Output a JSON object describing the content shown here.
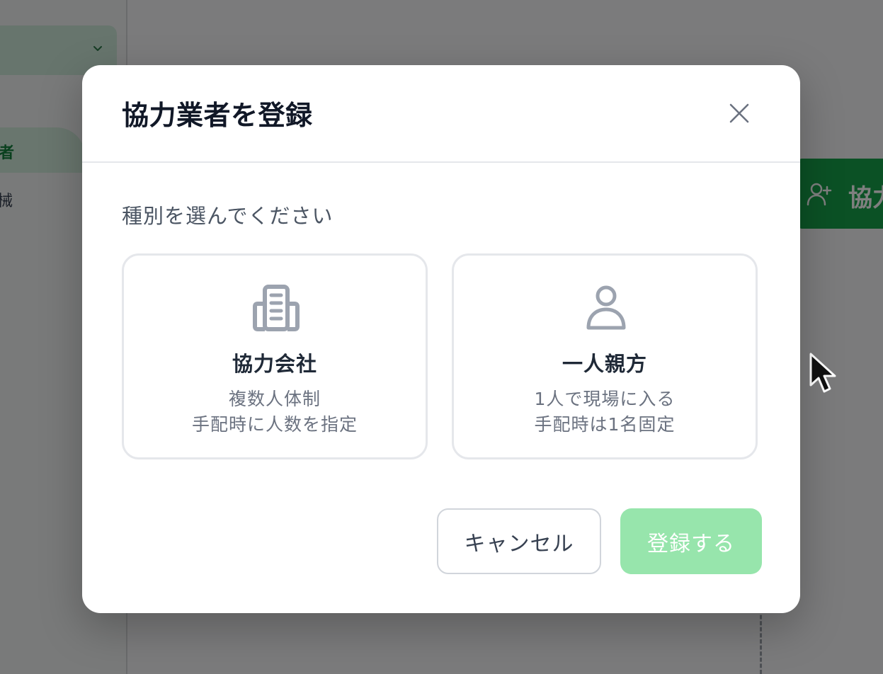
{
  "background": {
    "sidebar": {
      "active_item_label": "者",
      "item_label": "械"
    },
    "add_button_label": "協力"
  },
  "modal": {
    "title": "協力業者を登録",
    "prompt": "種別を選んでください",
    "options": [
      {
        "icon": "building-icon",
        "title": "協力会社",
        "line1": "複数人体制",
        "line2": "手配時に人数を指定"
      },
      {
        "icon": "person-icon",
        "title": "一人親方",
        "line1": "1人で現場に入る",
        "line2": "手配時は1名固定"
      }
    ],
    "cancel_label": "キャンセル",
    "submit_label": "登録する"
  },
  "colors": {
    "accent_green": "#16a34a",
    "submit_disabled": "#97e5ac",
    "title_text": "#111827"
  }
}
